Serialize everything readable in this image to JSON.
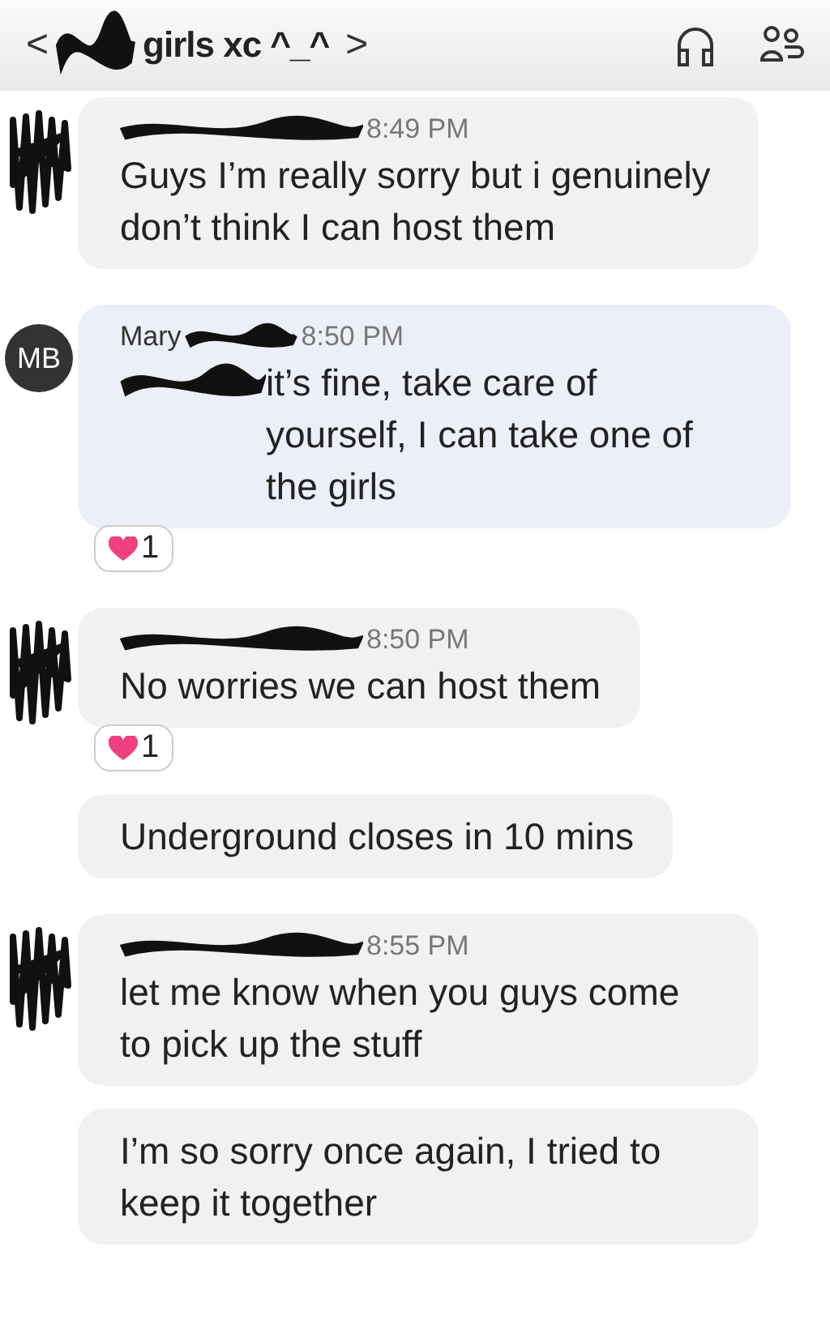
{
  "header": {
    "back": "<",
    "title": "girls xc ^_^",
    "chevron": ">",
    "avatar_redacted": true
  },
  "groups": [
    {
      "avatar": {
        "kind": "redacted"
      },
      "name_redacted": true,
      "time": "8:49 PM",
      "highlighted": false,
      "messages": [
        {
          "text": "Guys I’m really sorry but i genuinely don’t think I can host them"
        }
      ]
    },
    {
      "avatar": {
        "kind": "initials",
        "initials": "MB"
      },
      "sender": "Mary",
      "name_redacted": true,
      "time": "8:50 PM",
      "highlighted": true,
      "messages": [
        {
          "text": "it’s fine, take care of yourself, I can take one of the girls",
          "lead_redacted": true,
          "reaction": {
            "count": "1"
          }
        }
      ]
    },
    {
      "avatar": {
        "kind": "redacted"
      },
      "name_redacted": true,
      "time": "8:50 PM",
      "highlighted": false,
      "messages": [
        {
          "text": "No worries we can host them",
          "reaction": {
            "count": "1"
          }
        },
        {
          "text": "Underground closes in 10 mins"
        }
      ]
    },
    {
      "avatar": {
        "kind": "redacted"
      },
      "name_redacted": true,
      "time": "8:55 PM",
      "highlighted": false,
      "messages": [
        {
          "text": "let me know when you guys come to pick up the stuff"
        },
        {
          "text": "I’m so sorry once again, I tried to keep it together"
        }
      ]
    }
  ]
}
